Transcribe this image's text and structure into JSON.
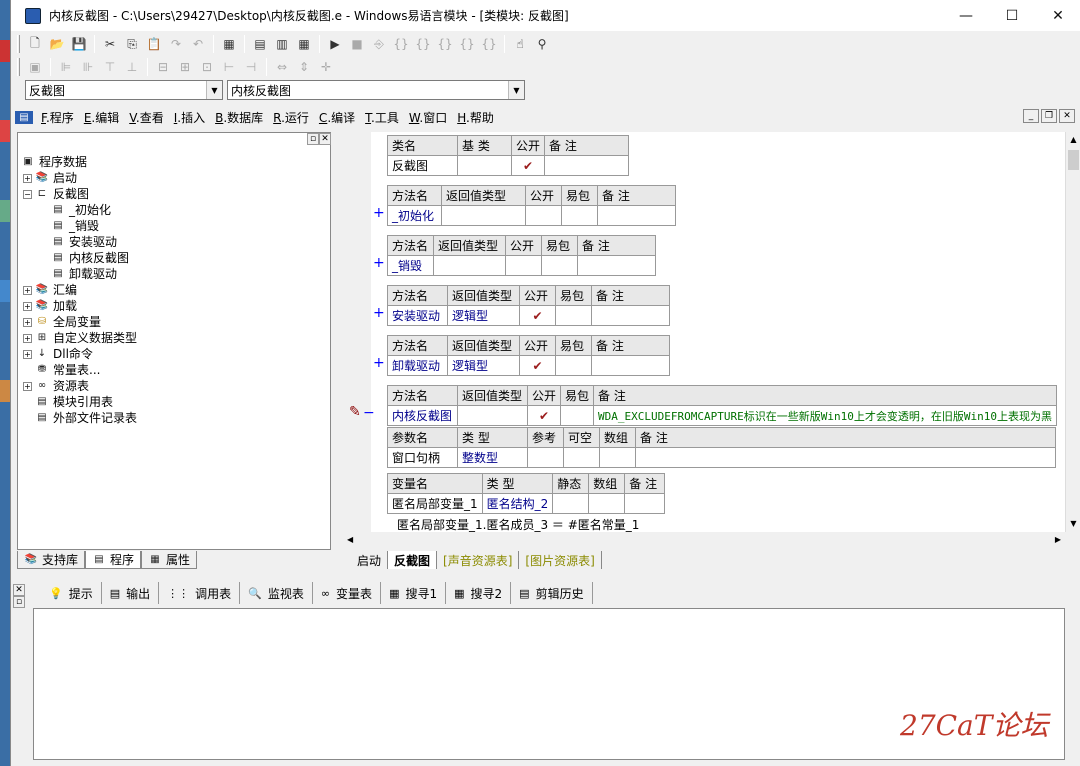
{
  "window": {
    "title": "内核反截图 - C:\\Users\\29427\\Desktop\\内核反截图.e - Windows易语言模块 - [类模块: 反截图]",
    "min": "—",
    "max": "☐",
    "close": "✕"
  },
  "combos": {
    "left": "反截图",
    "right": "内核反截图"
  },
  "menu": [
    {
      "key": "F",
      "label": ".程序"
    },
    {
      "key": "E",
      "label": ".编辑"
    },
    {
      "key": "V",
      "label": ".查看"
    },
    {
      "key": "I",
      "label": ".插入"
    },
    {
      "key": "B",
      "label": ".数据库"
    },
    {
      "key": "R",
      "label": ".运行"
    },
    {
      "key": "C",
      "label": ".编译"
    },
    {
      "key": "T",
      "label": ".工具"
    },
    {
      "key": "W",
      "label": ".窗口"
    },
    {
      "key": "H",
      "label": ".帮助"
    }
  ],
  "tree": {
    "root": "程序数据",
    "items": [
      "启动",
      "反截图",
      "_初始化",
      "_销毁",
      "安装驱动",
      "内核反截图",
      "卸载驱动",
      "汇编",
      "加载",
      "全局变量",
      "自定义数据类型",
      "Dll命令",
      "常量表...",
      "资源表",
      "模块引用表",
      "外部文件记录表"
    ]
  },
  "left_tabs": [
    "支持库",
    "程序",
    "属性"
  ],
  "class_table": {
    "headers": [
      "类名",
      "基 类",
      "公开",
      "备 注"
    ],
    "row": [
      "反截图",
      "",
      "✔",
      ""
    ]
  },
  "method_headers": [
    "方法名",
    "返回值类型",
    "公开",
    "易包",
    "备 注"
  ],
  "methods": [
    {
      "name": "_初始化",
      "ret": "",
      "pub": ""
    },
    {
      "name": "_销毁",
      "ret": "",
      "pub": ""
    },
    {
      "name": "安装驱动",
      "ret": "逻辑型",
      "pub": "✔"
    },
    {
      "name": "卸载驱动",
      "ret": "逻辑型",
      "pub": "✔"
    },
    {
      "name": "内核反截图",
      "ret": "",
      "pub": "✔",
      "note": "WDA_EXCLUDEFROMCAPTURE标识在一些新版Win10上才会变透明，在旧版Win10上表现为黑"
    }
  ],
  "param_headers": [
    "参数名",
    "类 型",
    "参考",
    "可空",
    "数组",
    "备 注"
  ],
  "param": {
    "name": "窗口句柄",
    "type": "整数型"
  },
  "var_headers": [
    "变量名",
    "类 型",
    "静态",
    "数组",
    "备 注"
  ],
  "var": {
    "name": "匿名局部变量_1",
    "type": "匿名结构_2"
  },
  "code_line": "匿名局部变量_1.匿名成员_3 ＝ #匿名常量_1",
  "plus": "+",
  "minus": "−",
  "editor_tabs": [
    "启动",
    "反截图",
    "[声音资源表]",
    "[图片资源表]"
  ],
  "output_tabs": [
    "提示",
    "输出",
    "调用表",
    "监视表",
    "变量表",
    "搜寻1",
    "搜寻2",
    "剪辑历史"
  ],
  "watermark": "27CaT论坛"
}
